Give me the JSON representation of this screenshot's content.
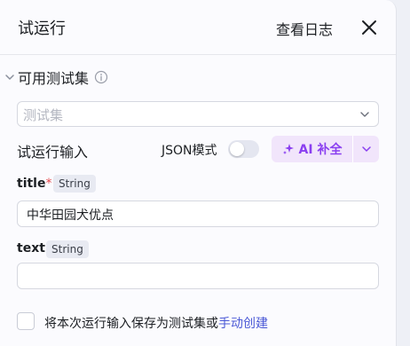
{
  "header": {
    "title": "试运行",
    "view_log": "查看日志"
  },
  "testset": {
    "label": "可用测试集",
    "placeholder": "测试集"
  },
  "run_input": {
    "label": "试运行输入",
    "json_mode_label": "JSON模式",
    "json_mode_on": false,
    "ai_button": "AI 补全"
  },
  "fields": [
    {
      "name": "title",
      "required": true,
      "required_mark": "*",
      "type": "String",
      "value": "中华田园犬优点"
    },
    {
      "name": "text",
      "required": false,
      "type": "String",
      "value": ""
    }
  ],
  "footer": {
    "save_prefix": "将本次运行输入保存为测试集或",
    "manual_create": "手动创建",
    "checked": false
  },
  "colors": {
    "accent_purple": "#8a3ff0",
    "ai_bg": "#f1e5fb",
    "link_blue": "#4b59d6",
    "required_red": "#e5484d"
  }
}
